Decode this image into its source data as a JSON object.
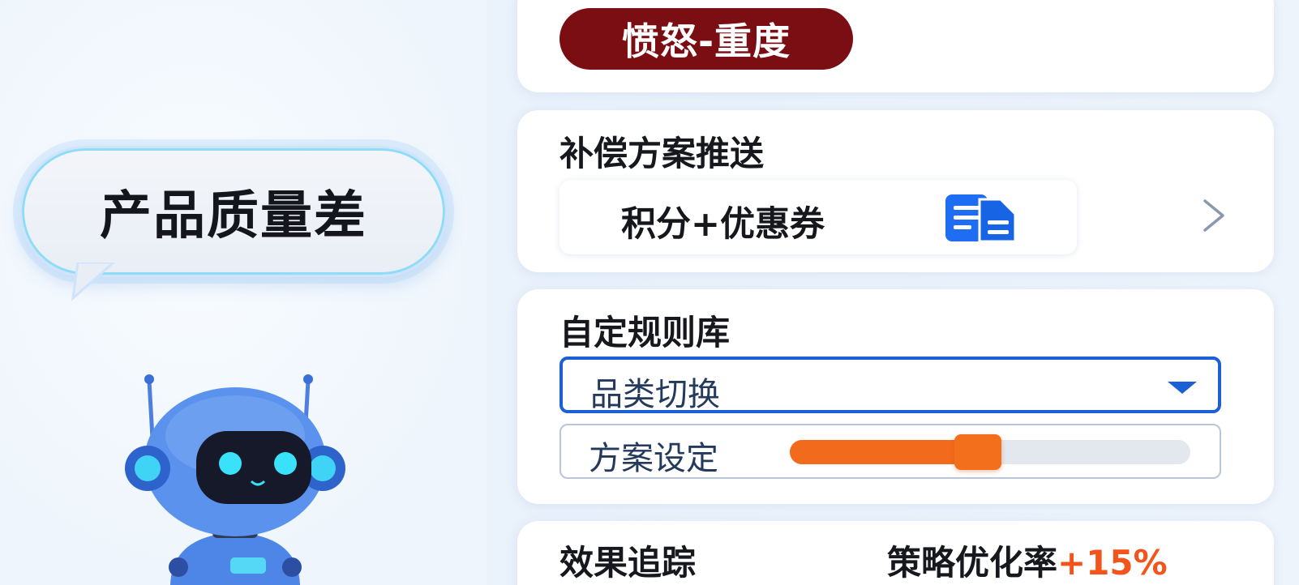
{
  "left": {
    "bubble_text": "产品质量差"
  },
  "emotion": {
    "label": "愤怒-重度",
    "color": "#7a0e12"
  },
  "compensation": {
    "title": "补偿方案推送",
    "option_label": "积分+优惠券",
    "option_icon": "document-list-icon",
    "nav_icon": "chevron-right-icon"
  },
  "rules": {
    "title": "自定规则库",
    "select_value": "品类切换",
    "slider_label": "方案设定",
    "slider_level": 0.47
  },
  "tracking": {
    "title": "效果追踪",
    "stat_label": "策略优化率",
    "stat_value": "+15%"
  },
  "colors": {
    "accent_blue": "#1d5fd6",
    "accent_orange": "#f26a1b",
    "emotion_red": "#7a0e12"
  }
}
